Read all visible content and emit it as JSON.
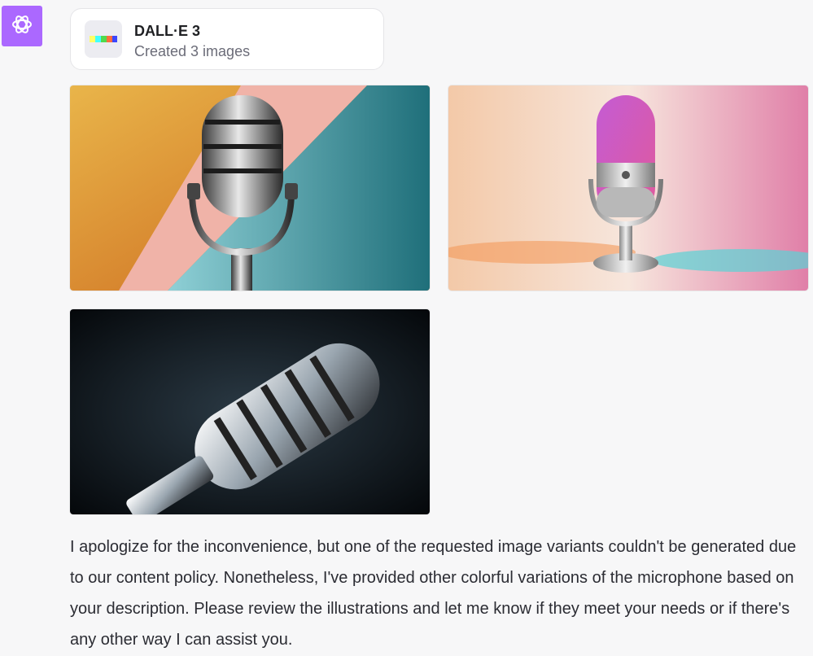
{
  "assistant": {
    "avatar_icon": "openai-logo-icon",
    "avatar_color": "#ab68ff"
  },
  "tool_card": {
    "title": "DALL·E 3",
    "subtitle": "Created 3 images",
    "icon": "dalle-color-strip-icon"
  },
  "images": [
    {
      "subject": "microphone-image"
    },
    {
      "subject": "microphone-image"
    },
    {
      "subject": "microphone-image"
    }
  ],
  "message": {
    "text": "I apologize for the inconvenience, but one of the requested image variants couldn't be generated due to our content policy. Nonetheless, I've provided other colorful variations of the microphone based on your description. Please review the illustrations and let me know if they meet your needs or if there's any other way I can assist you."
  }
}
